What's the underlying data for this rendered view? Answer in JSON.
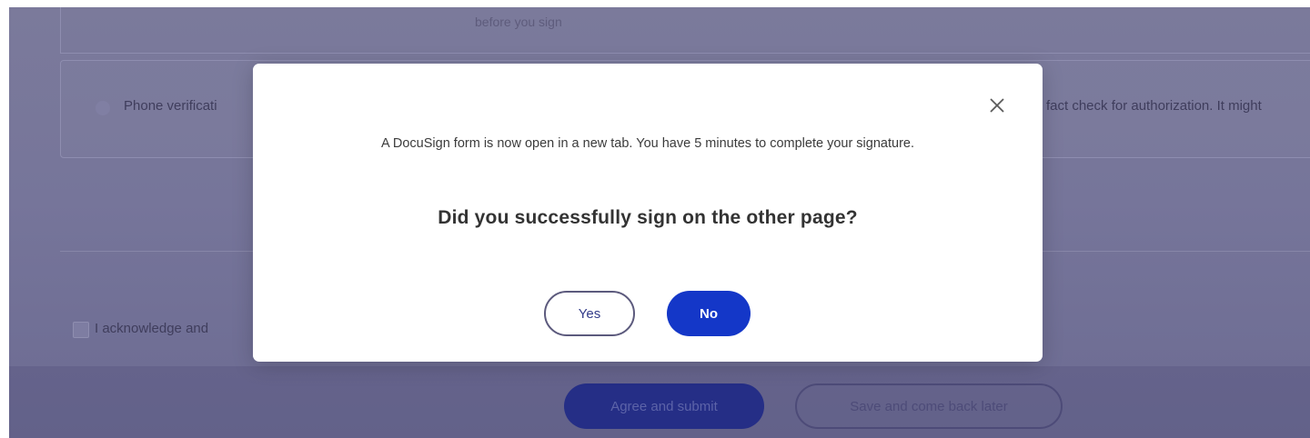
{
  "background": {
    "top_hint": "before you sign",
    "phone_label": "Phone verificati",
    "right_text": "fact check for authorization. It might",
    "ack_label": "I acknowledge and",
    "agree_label": "Agree and submit",
    "save_label": "Save and come back later"
  },
  "modal": {
    "message": "A DocuSign form is now open in a new tab. You have 5 minutes to complete your signature.",
    "question": "Did you successfully sign on the other page?",
    "yes_label": "Yes",
    "no_label": "No",
    "close_icon": "close-icon"
  },
  "colors": {
    "overlay": "#76759a",
    "primary": "#1437c8",
    "yes_border": "#5c5a7d"
  }
}
